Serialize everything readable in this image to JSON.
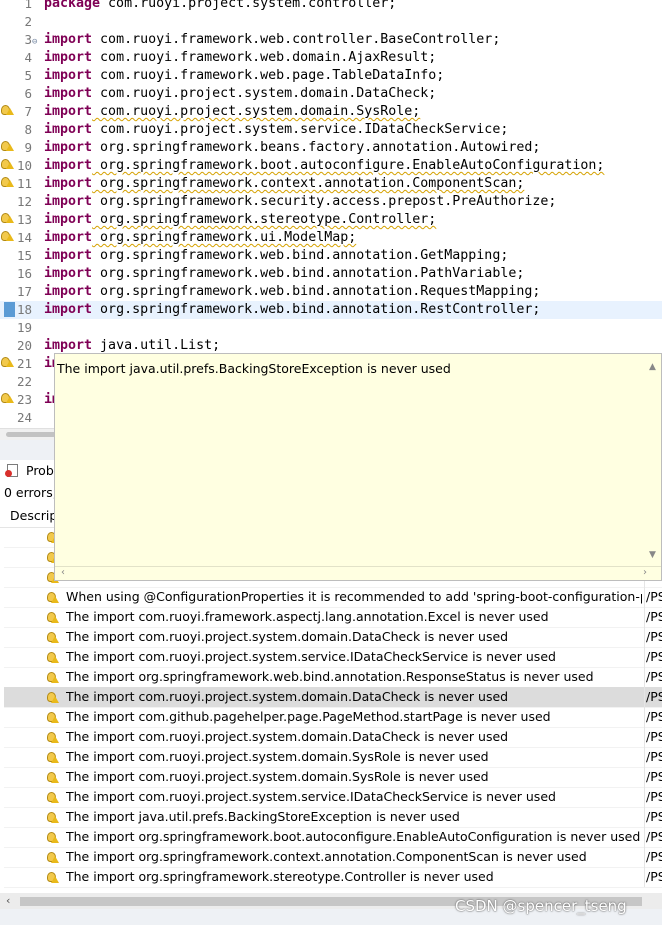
{
  "editor": {
    "lines": [
      {
        "num": "1",
        "kw": "package",
        "text": " com.ruoyi.project.system.controller;",
        "marker": ""
      },
      {
        "num": "2",
        "kw": "",
        "text": "",
        "marker": ""
      },
      {
        "num": "3",
        "kw": "import",
        "text": " com.ruoyi.framework.web.controller.BaseController;",
        "marker": "",
        "fold": "⊖"
      },
      {
        "num": "4",
        "kw": "import",
        "text": " com.ruoyi.framework.web.domain.AjaxResult;",
        "marker": ""
      },
      {
        "num": "5",
        "kw": "import",
        "text": " com.ruoyi.framework.web.page.TableDataInfo;",
        "marker": ""
      },
      {
        "num": "6",
        "kw": "import",
        "text": " com.ruoyi.project.system.domain.DataCheck;",
        "marker": ""
      },
      {
        "num": "7",
        "kw": "import",
        "text": " com.ruoyi.project.system.domain.SysRole;",
        "marker": "warning",
        "warn": true
      },
      {
        "num": "8",
        "kw": "import",
        "text": " com.ruoyi.project.system.service.IDataCheckService;",
        "marker": ""
      },
      {
        "num": "9",
        "kw": "import",
        "text": " org.springframework.beans.factory.annotation.Autowired;",
        "marker": "warning"
      },
      {
        "num": "10",
        "kw": "import",
        "text": " org.springframework.boot.autoconfigure.EnableAutoConfiguration;",
        "marker": "warning",
        "warn": true
      },
      {
        "num": "11",
        "kw": "import",
        "text": " org.springframework.context.annotation.ComponentScan;",
        "marker": "warning",
        "warn": true
      },
      {
        "num": "12",
        "kw": "import",
        "text": " org.springframework.security.access.prepost.PreAuthorize;",
        "marker": ""
      },
      {
        "num": "13",
        "kw": "import",
        "text": " org.springframework.stereotype.Controller;",
        "marker": "warning",
        "warn": true
      },
      {
        "num": "14",
        "kw": "import",
        "text": " org.springframework.ui.ModelMap;",
        "marker": "warning",
        "warn": true
      },
      {
        "num": "15",
        "kw": "import",
        "text": " org.springframework.web.bind.annotation.GetMapping;",
        "marker": ""
      },
      {
        "num": "16",
        "kw": "import",
        "text": " org.springframework.web.bind.annotation.PathVariable;",
        "marker": ""
      },
      {
        "num": "17",
        "kw": "import",
        "text": " org.springframework.web.bind.annotation.RequestMapping;",
        "marker": ""
      },
      {
        "num": "18",
        "kw": "import",
        "text": " org.springframework.web.bind.annotation.RestController;",
        "marker": "selected",
        "highlight": true
      },
      {
        "num": "19",
        "kw": "",
        "text": "",
        "marker": ""
      },
      {
        "num": "20",
        "kw": "import",
        "text": " java.util.List;",
        "marker": ""
      },
      {
        "num": "21",
        "kw": "im",
        "text": "",
        "marker": "warning"
      },
      {
        "num": "22",
        "kw": "",
        "text": "",
        "marker": ""
      },
      {
        "num": "23",
        "kw": "im",
        "text": "",
        "marker": "warning"
      },
      {
        "num": "24",
        "kw": "",
        "text": "",
        "marker": ""
      }
    ]
  },
  "tooltip": {
    "message": "The import java.util.prefs.BackingStoreException is never used"
  },
  "problems": {
    "tab_label": "Probl",
    "summary": "0 errors,",
    "column_description": "Descrip",
    "rows": [
      {
        "desc": "",
        "res": "",
        "selected": false
      },
      {
        "desc": "",
        "res": "",
        "selected": false
      },
      {
        "desc": "",
        "res": "",
        "selected": false
      },
      {
        "desc": "When using @ConfigurationProperties it is recommended to add 'spring-boot-configuration-proce",
        "res": "/PS",
        "selected": false
      },
      {
        "desc": "The import com.ruoyi.framework.aspectj.lang.annotation.Excel is never used",
        "res": "/PS",
        "selected": false
      },
      {
        "desc": "The import com.ruoyi.project.system.domain.DataCheck is never used",
        "res": "/PS",
        "selected": false
      },
      {
        "desc": "The import com.ruoyi.project.system.service.IDataCheckService is never used",
        "res": "/PS",
        "selected": false
      },
      {
        "desc": "The import org.springframework.web.bind.annotation.ResponseStatus is never used",
        "res": "/PS",
        "selected": false
      },
      {
        "desc": "The import com.ruoyi.project.system.domain.DataCheck is never used",
        "res": "/PS",
        "selected": true
      },
      {
        "desc": "The import com.github.pagehelper.page.PageMethod.startPage is never used",
        "res": "/PS",
        "selected": false
      },
      {
        "desc": "The import com.ruoyi.project.system.domain.DataCheck is never used",
        "res": "/PS",
        "selected": false
      },
      {
        "desc": "The import com.ruoyi.project.system.domain.SysRole is never used",
        "res": "/PS",
        "selected": false
      },
      {
        "desc": "The import com.ruoyi.project.system.domain.SysRole is never used",
        "res": "/PS",
        "selected": false
      },
      {
        "desc": "The import com.ruoyi.project.system.service.IDataCheckService is never used",
        "res": "/PS",
        "selected": false
      },
      {
        "desc": "The import java.util.prefs.BackingStoreException is never used",
        "res": "/PS",
        "selected": false
      },
      {
        "desc": "The import org.springframework.boot.autoconfigure.EnableAutoConfiguration is never used",
        "res": "/PS",
        "selected": false
      },
      {
        "desc": "The import org.springframework.context.annotation.ComponentScan is never used",
        "res": "/PS",
        "selected": false
      },
      {
        "desc": "The import org.springframework.stereotype.Controller is never used",
        "res": "/PS",
        "selected": false
      }
    ]
  },
  "watermark": "CSDN @spencer_tseng",
  "icons": {
    "warning": "lightbulb-warning-icon",
    "problems": "problems-view-icon"
  },
  "colors": {
    "keyword": "#7f0055",
    "tooltip_bg": "#ffffe1",
    "selected_row": "#dcdcdc",
    "current_line": "#e8f2fe",
    "warning": "#e9b91a"
  }
}
